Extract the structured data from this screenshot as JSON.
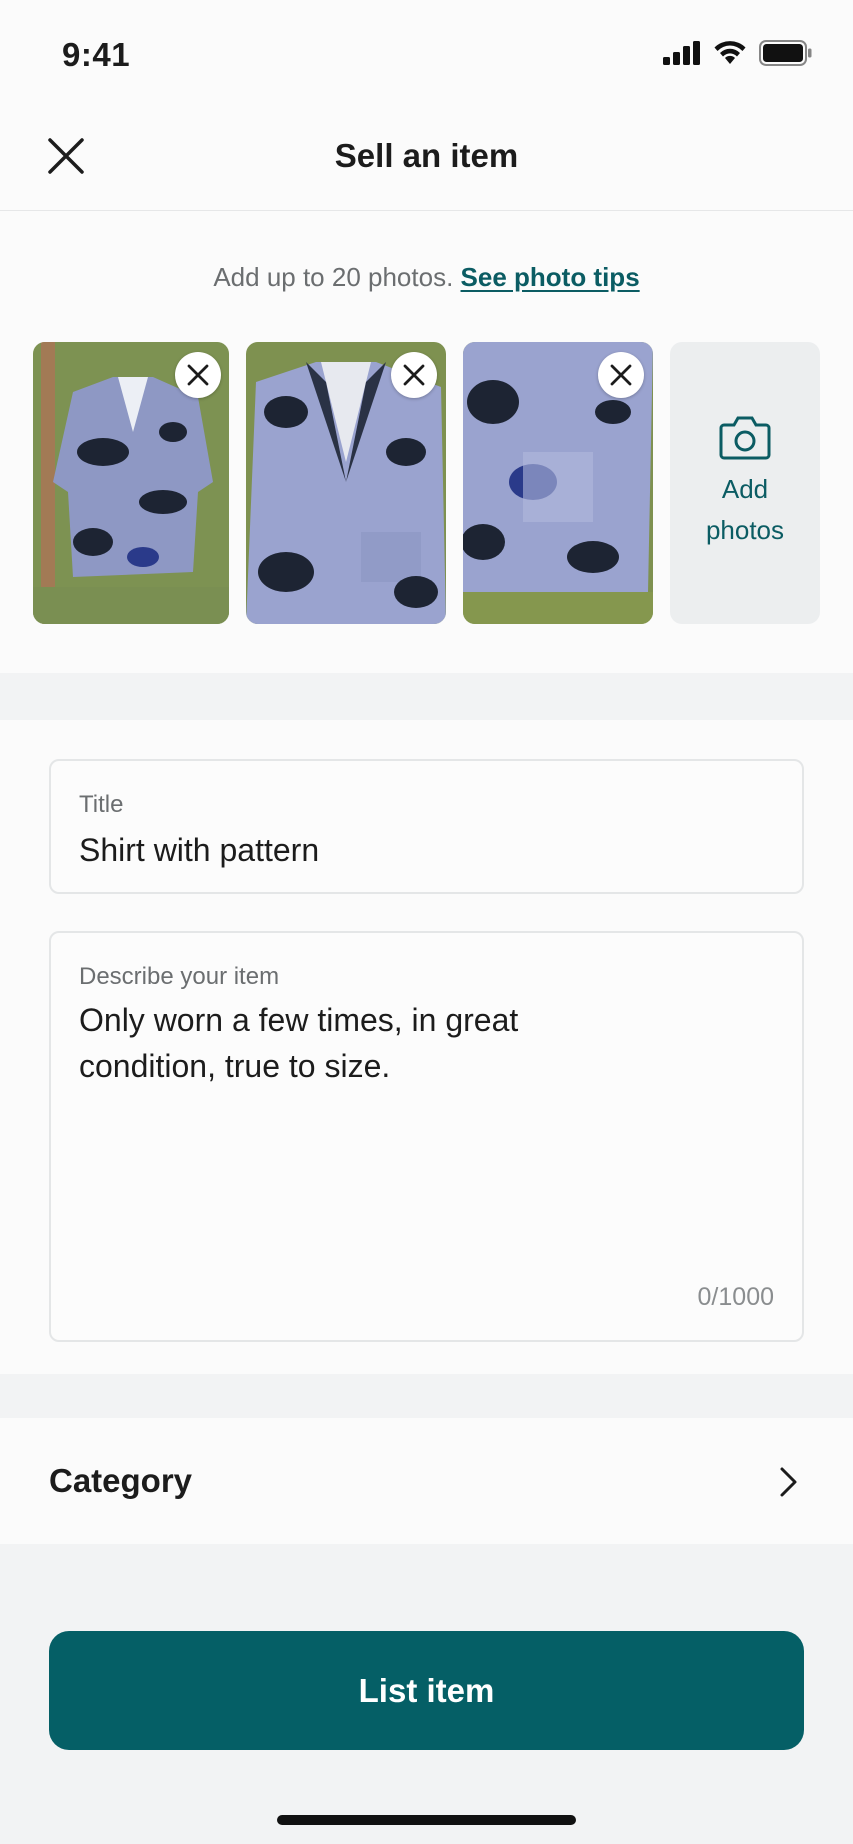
{
  "status_bar": {
    "time": "9:41"
  },
  "header": {
    "title": "Sell an item"
  },
  "photos": {
    "hint": "Add up to 20 photos.",
    "tips_link": "See photo tips",
    "add_label": "Add photos",
    "thumbnails": [
      {
        "alt": "shirt-photo-1"
      },
      {
        "alt": "shirt-photo-2"
      },
      {
        "alt": "shirt-photo-3"
      }
    ]
  },
  "form": {
    "title_label": "Title",
    "title_value": "Shirt with pattern",
    "description_label": "Describe your item",
    "description_value": "Only worn a few times, in great condition, true to size.",
    "counter": "0/1000"
  },
  "category": {
    "label": "Category"
  },
  "primary_action": {
    "label": "List item"
  },
  "colors": {
    "accent": "#055f66",
    "link": "#0b5c63"
  }
}
